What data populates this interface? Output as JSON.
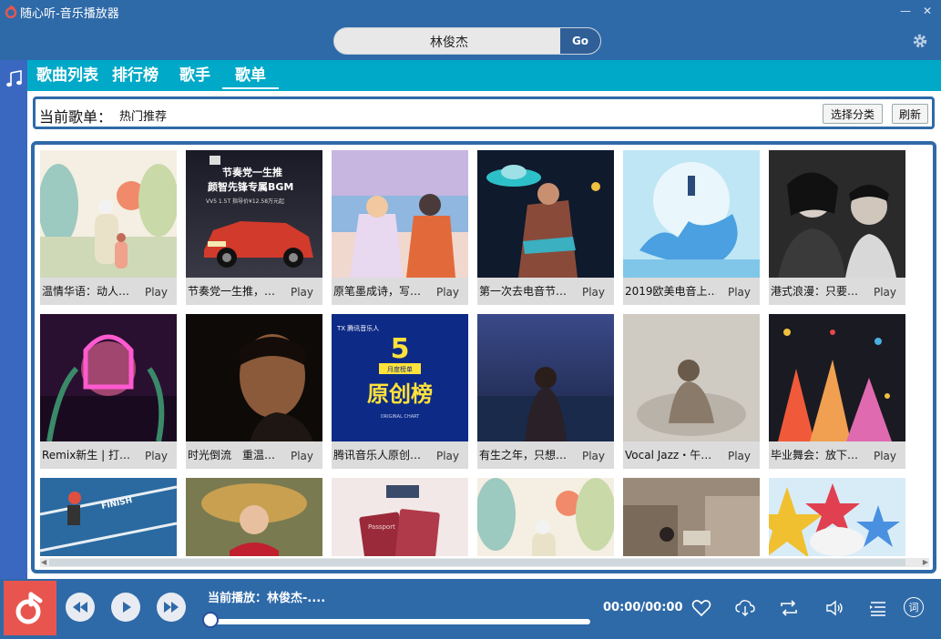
{
  "app": {
    "title": "随心听-音乐播放器",
    "window": {
      "minimize": "—",
      "close": "✕"
    }
  },
  "search": {
    "value": "林俊杰",
    "go_label": "Go"
  },
  "tabs": [
    {
      "label": "歌曲列表"
    },
    {
      "label": "排行榜"
    },
    {
      "label": "歌手"
    },
    {
      "label": "歌单",
      "active": true
    }
  ],
  "current_playlist": {
    "label": "当前歌单：",
    "value": "热门推荐",
    "choose_label": "选择分类",
    "refresh_label": "刷新"
  },
  "cards": [
    {
      "name": "温情华语：动人…",
      "play": "Play"
    },
    {
      "name": "节奏党一生推，…",
      "play": "Play"
    },
    {
      "name": "原笔墨成诗，写…",
      "play": "Play"
    },
    {
      "name": "第一次去电音节…",
      "play": "Play"
    },
    {
      "name": "2019欧美电音上…",
      "play": "Play"
    },
    {
      "name": "港式浪漫：只要…",
      "play": "Play"
    },
    {
      "name": "Remix新生 | 打…",
      "play": "Play"
    },
    {
      "name": "时光倒流　重温…",
      "play": "Play"
    },
    {
      "name": "腾讯音乐人原创…",
      "play": "Play"
    },
    {
      "name": "有生之年，只想…",
      "play": "Play"
    },
    {
      "name": "Vocal Jazz・午…",
      "play": "Play"
    },
    {
      "name": "毕业舞会：放下…",
      "play": "Play"
    }
  ],
  "cover_text": {
    "c2_line1": "节奏党一生推",
    "c2_line2": "颜智先锋专属BGM",
    "c2_price": "VV5 1.5T 指导价¥12.58万元起",
    "c9_brand": "TX 腾讯音乐人",
    "c9_num": "5",
    "c9_sub": "月度榜单",
    "c9_title": "原创榜",
    "c9_eng": "ORIGINAL CHART",
    "c13_finish": "FINISH",
    "c15_passport": "Passport"
  },
  "player": {
    "now_playing": "当前播放：林俊杰-....",
    "time": "00:00/00:00",
    "progress": 0,
    "lyrics_label": "词"
  },
  "colors": {
    "titlebar": "#2f6aa8",
    "nav": "#00a9c8",
    "sidebar": "#3a68c0",
    "accent_red": "#e8554f"
  }
}
